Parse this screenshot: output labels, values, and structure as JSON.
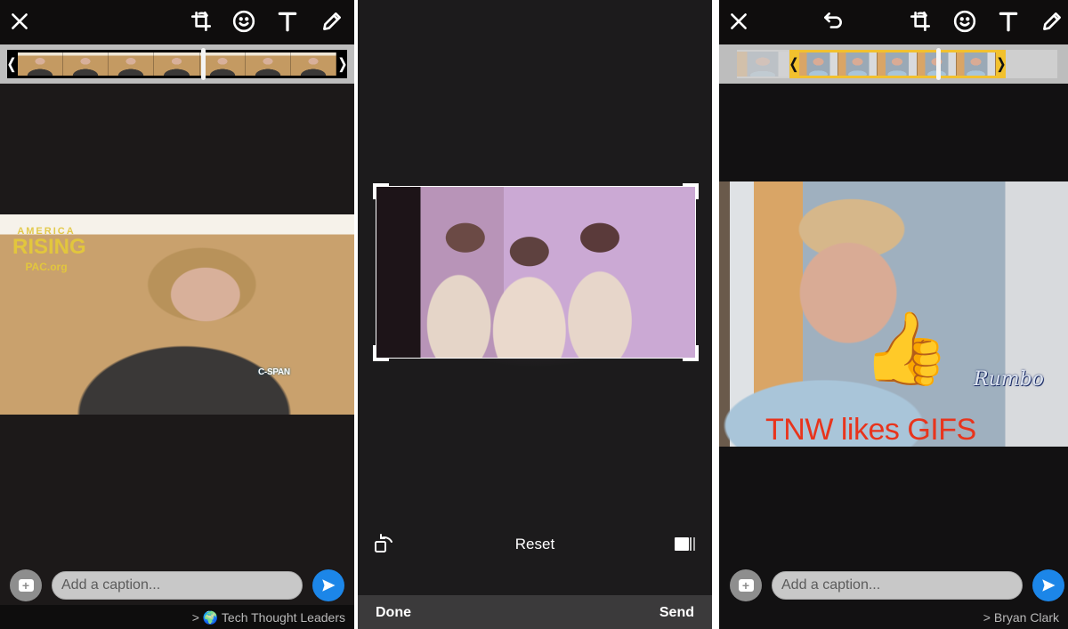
{
  "panels": {
    "left": {
      "toolbar": {
        "close_icon": "close-icon",
        "crop_icon": "crop-rotate-icon",
        "emoji_icon": "smiley-icon",
        "text_icon": "text-icon",
        "draw_icon": "pencil-icon"
      },
      "timeline": {
        "left_handle": "❬",
        "right_handle": "❭"
      },
      "video": {
        "watermark_line1": "AMERICA",
        "watermark_line2": "RISING",
        "watermark_line3": "PAC.org",
        "network_logo": "C-SPAN"
      },
      "caption": {
        "placeholder": "Add a caption...",
        "value": ""
      },
      "recipient": {
        "chevron": ">",
        "emoji": "🌍",
        "name": "Tech Thought Leaders"
      }
    },
    "middle": {
      "crop_controls": {
        "rotate_icon": "rotate-icon",
        "reset_label": "Reset",
        "aspect_icon": "aspect-ratio-icon"
      },
      "bottom_bar": {
        "done_label": "Done",
        "send_label": "Send"
      }
    },
    "right": {
      "toolbar": {
        "close_icon": "close-icon",
        "undo_icon": "undo-icon",
        "crop_icon": "crop-rotate-icon",
        "emoji_icon": "smiley-icon",
        "text_icon": "text-icon",
        "draw_icon": "pencil-icon"
      },
      "timeline": {
        "left_handle": "❬",
        "right_handle": "❭"
      },
      "video": {
        "sticker": "👍",
        "overlay_text": "TNW likes GIFS",
        "overlay_color": "#e8341c",
        "signature": "Rumbo"
      },
      "caption": {
        "placeholder": "Add a caption...",
        "value": ""
      },
      "recipient": {
        "chevron": ">",
        "name": "Bryan Clark"
      }
    }
  },
  "colors": {
    "send_button": "#1c86e8",
    "trim_selection": "#f2c12e",
    "panel_bg": "#1c1919"
  }
}
